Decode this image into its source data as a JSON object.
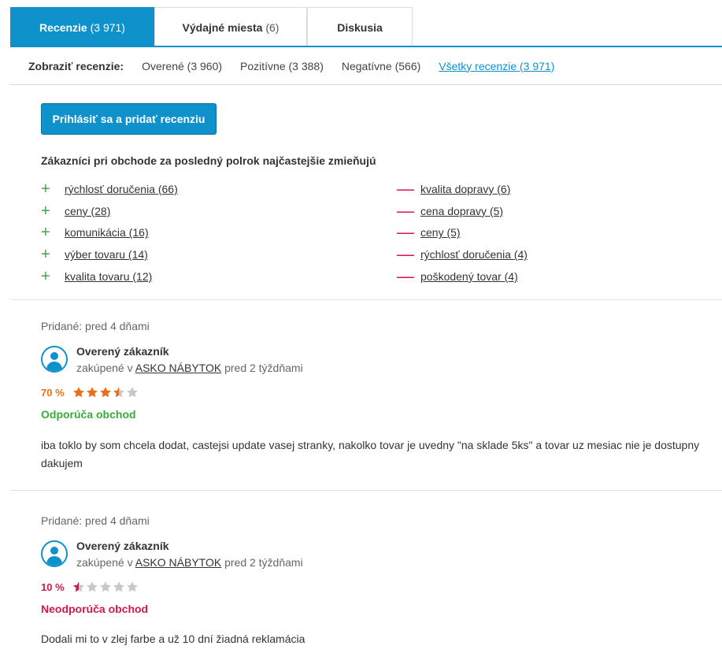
{
  "tabs": [
    {
      "label": "Recenzie",
      "count": "(3 971)"
    },
    {
      "label": "Výdajné miesta",
      "count": "(6)"
    },
    {
      "label": "Diskusia",
      "count": ""
    }
  ],
  "filter": {
    "label": "Zobraziť recenzie:",
    "items": [
      "Overené (3 960)",
      "Pozitívne (3 388)",
      "Negatívne (566)",
      "Všetky recenzie (3 971)"
    ]
  },
  "add_button": "Prihlásiť sa a pridať recenziu",
  "mentions": {
    "title": "Zákazníci pri obchode za posledný polrok najčastejšie zmieňujú",
    "positive": [
      "rýchlosť doručenia (66)",
      "ceny (28)",
      "komunikácia (16)",
      "výber tovaru (14)",
      "kvalita tovaru (12)"
    ],
    "negative": [
      "kvalita dopravy (6)",
      "cena dopravy (5)",
      "ceny (5)",
      "rýchlosť doručenia (4)",
      "poškodený tovar (4)"
    ],
    "plus_sign": "+",
    "minus_sign": "—"
  },
  "colors": {
    "accent": "#0f92cc",
    "positive": "#3aaa3a",
    "negative": "#d4174c",
    "rating_orange": "#e8701a",
    "star_empty": "#c8c8c8"
  },
  "reviews": [
    {
      "added": "Pridané: pred 4 dňami",
      "user": "Overený zákazník",
      "bought_prefix": "zakúpené v",
      "shop": "ASKO NÁBYTOK",
      "bought_suffix": "pred 2 týždňami",
      "rating_pct": "70 %",
      "rating_value": 3.5,
      "recommendation": "Odporúča obchod",
      "recommends": true,
      "text": "iba toklo by som chcela dodat, castejsi update vasej stranky, nakolko tovar je uvedny \"na sklade 5ks\" a tovar uz mesiac nie je dostupny dakujem"
    },
    {
      "added": "Pridané: pred 4 dňami",
      "user": "Overený zákazník",
      "bought_prefix": "zakúpené v",
      "shop": "ASKO NÁBYTOK",
      "bought_suffix": "pred 2 týždňami",
      "rating_pct": "10 %",
      "rating_value": 0.5,
      "recommendation": "Neodporúča obchod",
      "recommends": false,
      "text": "Dodali mi to v zlej farbe a už 10 dní žiadná reklamácia"
    }
  ]
}
